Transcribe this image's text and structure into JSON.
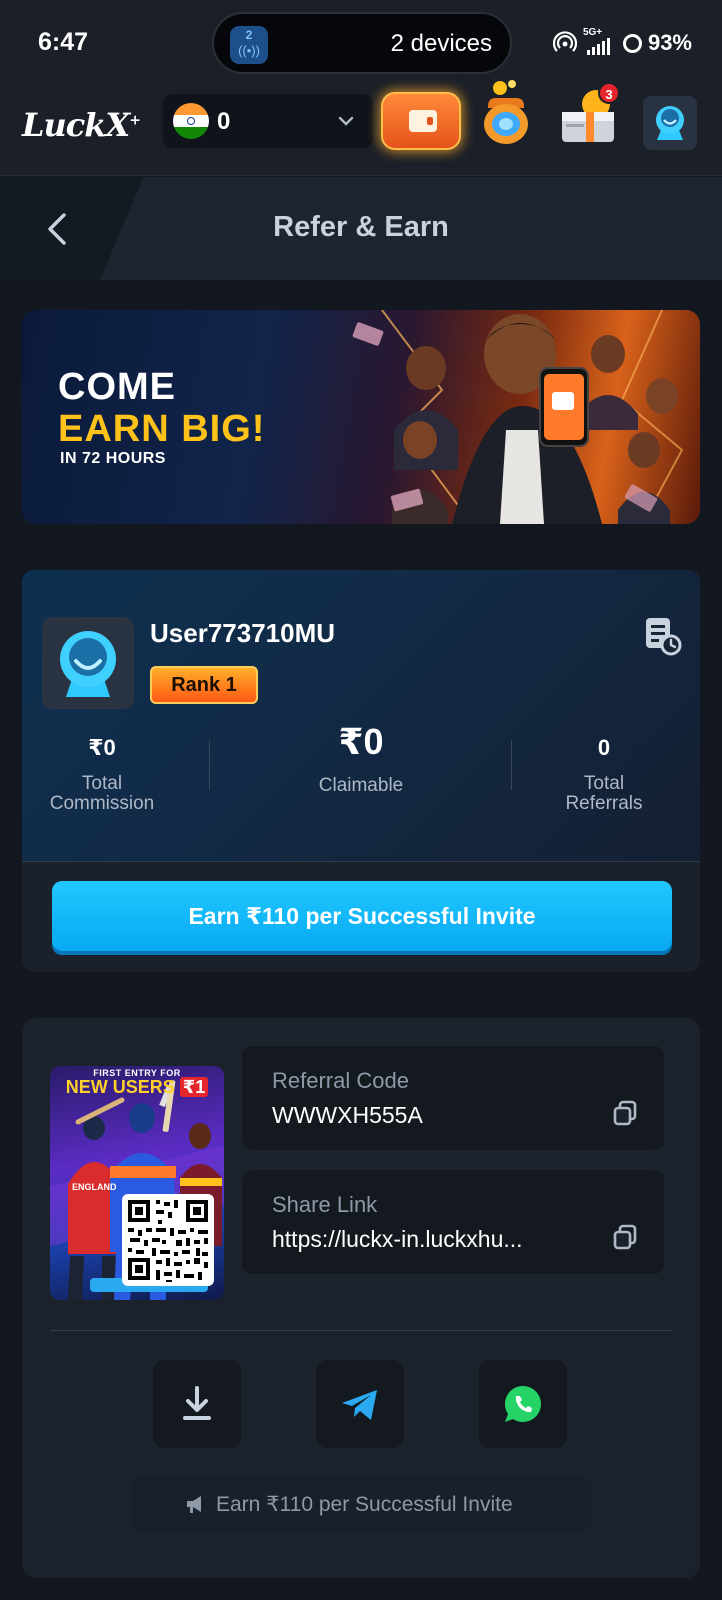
{
  "status_bar": {
    "time": "6:47",
    "island_count": "2",
    "island_text": "2 devices",
    "network": "5G+",
    "battery": "93%"
  },
  "app_bar": {
    "logo": "LuckX",
    "balance": "0",
    "country": "India",
    "notification_count": "3"
  },
  "page": {
    "title": "Refer & Earn"
  },
  "banner": {
    "line1": "COME",
    "line2": "EARN BIG!",
    "line3": "IN 72 HOURS"
  },
  "profile": {
    "username": "User773710MU",
    "rank": "Rank 1",
    "stats": {
      "commission_value": "₹0",
      "commission_label_1": "Total",
      "commission_label_2": "Commission",
      "claimable_value": "₹0",
      "claimable_label": "Claimable",
      "referrals_value": "0",
      "referrals_label_1": "Total",
      "referrals_label_2": "Referrals"
    },
    "earn_button": "Earn ₹110 per Successful Invite"
  },
  "referral": {
    "poster_top": "FIRST ENTRY FOR",
    "poster_title": "NEW USERS",
    "poster_price": "₹1",
    "poster_team": "ENGLAND",
    "code_label": "Referral Code",
    "code_value": "WWWXH555A",
    "link_label": "Share Link",
    "link_value": "https://luckx-in.luckxhu...",
    "share_buttons": [
      "download-icon",
      "telegram-icon",
      "whatsapp-icon"
    ],
    "promo_text": "Earn ₹110 per Successful Invite"
  },
  "colors": {
    "accent_blue": "#08a9f2",
    "rank_orange": "#ff5a14",
    "banner_yellow": "#ffc21a",
    "whatsapp_green": "#25d366",
    "telegram_blue": "#2aa9f0"
  }
}
